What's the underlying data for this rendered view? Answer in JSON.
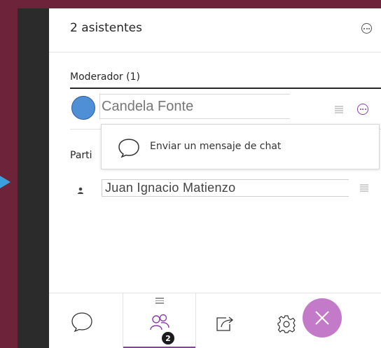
{
  "header": {
    "title": "2 asistentes"
  },
  "moderators": {
    "title": "Moderador (1)",
    "items": [
      {
        "name": "Candela Fonte"
      }
    ]
  },
  "participants": {
    "title_visible": "Parti",
    "items": [
      {
        "name": "Juan Ignacio Matienzo"
      }
    ]
  },
  "popup": {
    "chat_label": "Enviar un mensaje de chat"
  },
  "bottom_bar": {
    "active_tab": "attendees",
    "attendees_badge": "2",
    "tabs": [
      "chat-icon",
      "attendees-icon",
      "share-icon",
      "settings-icon",
      "close-icon"
    ]
  },
  "colors": {
    "background": "#6d2339",
    "accent": "#8a3fa8",
    "avatar": "#4f8fd6",
    "arrow": "#3aa0dd",
    "close": "#c37ac9"
  }
}
